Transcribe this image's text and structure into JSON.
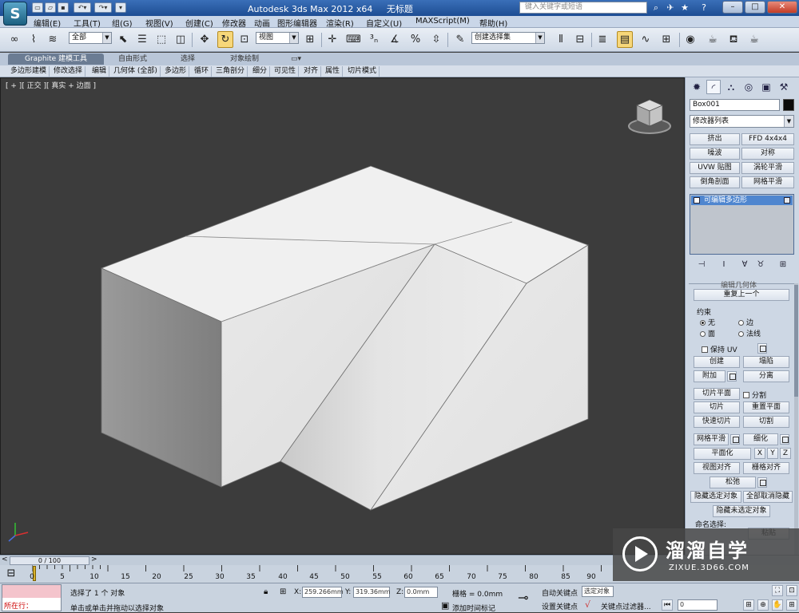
{
  "titlebar": {
    "app_title": "Autodesk 3ds Max  2012 x64",
    "doc_title": "无标题",
    "search_placeholder": "键入关键字或短语",
    "logo_letter": "S"
  },
  "menu": [
    "编辑(E)",
    "工具(T)",
    "组(G)",
    "视图(V)",
    "创建(C)",
    "修改器",
    "动画",
    "图形编辑器",
    "渲染(R)",
    "自定义(U)",
    "MAXScript(M)",
    "帮助(H)"
  ],
  "toolbar": {
    "selection_filter": "全部",
    "ref_coord": "视图",
    "named_selection": "创建选择集"
  },
  "ribbon": {
    "tabs": [
      "Graphite 建模工具",
      "自由形式",
      "选择",
      "对象绘制"
    ],
    "panel_items": [
      "多边形建模",
      "修改选择",
      "编辑",
      "几何体 (全部)",
      "多边形",
      "循环",
      "三角剖分",
      "细分",
      "可见性",
      "对齐",
      "属性",
      "切片模式"
    ]
  },
  "viewport": {
    "label": "[ + ][ 正交 ][ 真实 + 边面 ]",
    "background": "#3c3c3c",
    "object_color": "#ededed"
  },
  "command_panel": {
    "object_name": "Box001",
    "modifier_list": "修改器列表",
    "modifier_buttons": [
      "挤出",
      "FFD 4x4x4",
      "噪波",
      "对称",
      "UVW 贴图",
      "涡轮平滑",
      "倒角剖面",
      "网格平滑"
    ],
    "stack_item": "可编辑多边形",
    "repeat_last": "重复上一个",
    "constraints_label": "约束",
    "constraint_none": "无",
    "constraint_edge": "边",
    "constraint_face": "面",
    "constraint_normal": "法线",
    "preserve_uv": "保持 UV",
    "create": "创建",
    "collapse": "塌陷",
    "attach": "附加",
    "detach": "分离",
    "slice_plane": "切片平面",
    "split": "分割",
    "slice": "切片",
    "reset_plane": "重置平面",
    "quickslice": "快速切片",
    "cut": "切割",
    "meshsmooth": "网格平滑",
    "tessellate": "细化",
    "make_planar": "平面化",
    "x": "X",
    "y": "Y",
    "z": "Z",
    "view_align": "视图对齐",
    "grid_align": "栅格对齐",
    "relax": "松弛",
    "hide_selected": "隐藏选定对象",
    "unhide_all": "全部取消隐藏",
    "hide_unselected": "隐藏未选定对象",
    "named_sel": "命名选择:",
    "paste": "粘贴",
    "partial_header": "编辑几何体"
  },
  "timeline": {
    "frame_display": "0 / 100",
    "ticks": [
      "0",
      "5",
      "10",
      "15",
      "20",
      "25",
      "30",
      "35",
      "40",
      "45",
      "50",
      "55",
      "60",
      "65",
      "70",
      "75",
      "80",
      "85",
      "90"
    ]
  },
  "status": {
    "maxscript_text": "所在行：",
    "line1": "选择了 1 个 对象",
    "line2": "单击或单击并拖动以选择对象",
    "x_label": "X:",
    "x_value": "259.266mm",
    "y_label": "Y:",
    "y_value": "319.36mm",
    "z_label": "Z:",
    "z_value": "0.0mm",
    "grid": "栅格 = 0.0mm",
    "auto_key": "自动关键点",
    "set_key": "设置关键点",
    "selected": "选定对象",
    "key_filters": "关键点过滤器...",
    "add_time_tag": "添加时间标记",
    "frame": "0"
  },
  "watermark": {
    "title": "溜溜自学",
    "subtitle": "ZIXUE.3D66.COM"
  }
}
